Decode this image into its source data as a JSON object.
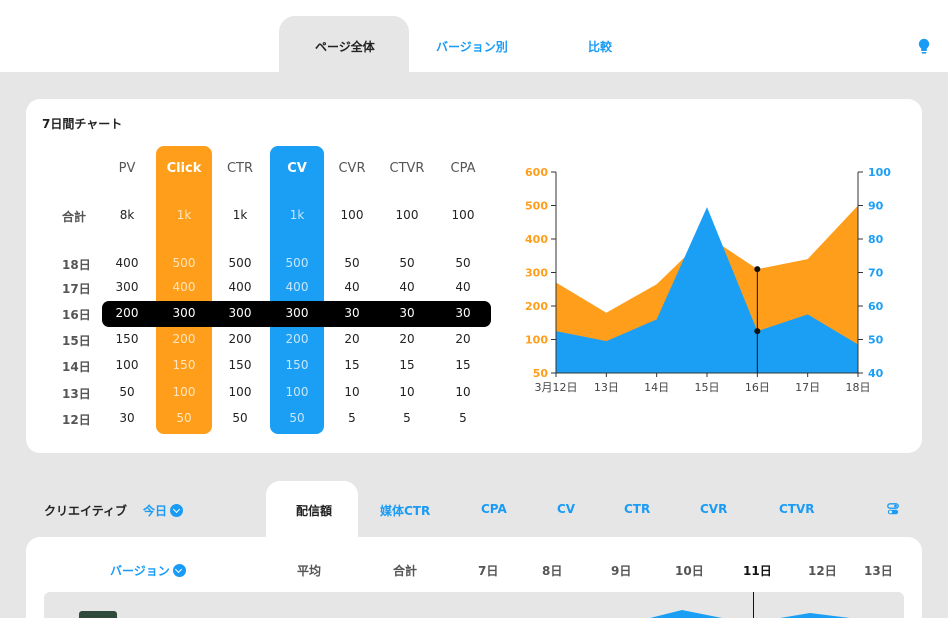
{
  "top_tabs": [
    {
      "label": "ページ全体",
      "active": true
    },
    {
      "label": "バージョン別",
      "active": false
    },
    {
      "label": "比較",
      "active": false
    }
  ],
  "icons": {
    "hint": "lightbulb-icon",
    "settings": "toggle-settings-icon"
  },
  "colors": {
    "orange": "#ff9e1b",
    "blue": "#1b9ff5",
    "text": "#222222"
  },
  "chart_card": {
    "title": "7日間チャート",
    "table": {
      "columns": [
        "PV",
        "Click",
        "CTR",
        "CV",
        "CVR",
        "CTVR",
        "CPA"
      ],
      "total_label": "合計",
      "totals": [
        "8k",
        "1k",
        "1k",
        "1k",
        "100",
        "100",
        "100"
      ],
      "rows": [
        {
          "day": "18日",
          "values": [
            "400",
            "500",
            "500",
            "500",
            "50",
            "50",
            "50"
          ]
        },
        {
          "day": "17日",
          "values": [
            "300",
            "400",
            "400",
            "400",
            "40",
            "40",
            "40"
          ]
        },
        {
          "day": "16日",
          "values": [
            "200",
            "300",
            "300",
            "300",
            "30",
            "30",
            "30"
          ]
        },
        {
          "day": "15日",
          "values": [
            "150",
            "200",
            "200",
            "200",
            "20",
            "20",
            "20"
          ]
        },
        {
          "day": "14日",
          "values": [
            "100",
            "150",
            "150",
            "150",
            "15",
            "15",
            "15"
          ]
        },
        {
          "day": "13日",
          "values": [
            "50",
            "100",
            "100",
            "100",
            "10",
            "10",
            "10"
          ]
        },
        {
          "day": "12日",
          "values": [
            "30",
            "50",
            "50",
            "50",
            "5",
            "5",
            "5"
          ]
        }
      ],
      "selected_row": "16日"
    }
  },
  "chart_data": {
    "type": "area",
    "x": [
      "3月12日",
      "13日",
      "14日",
      "15日",
      "16日",
      "17日",
      "18日"
    ],
    "left_axis": {
      "ticks": [
        50,
        100,
        200,
        300,
        400,
        500,
        600
      ],
      "ylim": [
        50,
        600
      ]
    },
    "right_axis": {
      "ticks": [
        40,
        50,
        60,
        70,
        80,
        90,
        100
      ],
      "ylim": [
        40,
        100
      ]
    },
    "series": [
      {
        "color": "#ff9e1b",
        "axis": "left",
        "values": [
          270,
          180,
          265,
          410,
          310,
          340,
          500
        ]
      },
      {
        "color": "#1b9ff5",
        "axis": "right",
        "values": [
          52.5,
          49.5,
          56,
          89.5,
          52.5,
          57.5,
          48.5
        ]
      }
    ],
    "selected_x": "16日",
    "grid": false
  },
  "bottom": {
    "section_title": "クリエイティブ",
    "period": "今日",
    "metric_tabs": [
      {
        "label": "配信額",
        "active": true
      },
      {
        "label": "媒体CTR",
        "active": false
      },
      {
        "label": "CPA",
        "active": false
      },
      {
        "label": "CV",
        "active": false
      },
      {
        "label": "CTR",
        "active": false
      },
      {
        "label": "CVR",
        "active": false
      },
      {
        "label": "CTVR",
        "active": false
      }
    ],
    "table_headers": {
      "version": "バージョン",
      "average": "平均",
      "total": "合計",
      "days": [
        "7日",
        "8日",
        "9日",
        "10日",
        "11日",
        "12日",
        "13日"
      ],
      "selected_day": "11日"
    }
  }
}
